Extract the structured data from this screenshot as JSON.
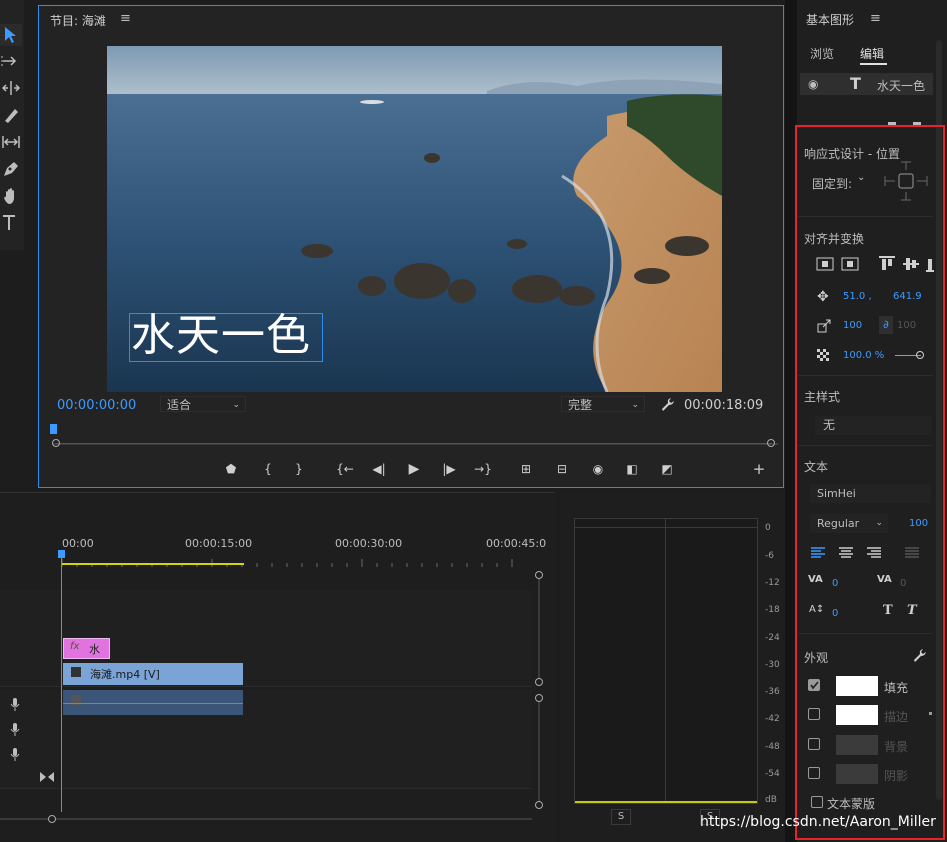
{
  "monitor": {
    "title": "节目: 海滩",
    "menu_icon": "≡",
    "current_time": "00:00:00:00",
    "fit_option": "适合",
    "quality_option": "完整",
    "duration": "00:00:18:09",
    "overlay_text": "水天一色"
  },
  "timeline": {
    "ruler": [
      "00:00",
      "00:00:15:00",
      "00:00:30:00",
      "00:00:45:0"
    ],
    "graphic_clip_label": "水",
    "video_clip_label": "海滩.mp4 [V]",
    "fx_label": "fx"
  },
  "meter": {
    "db_labels": [
      "0",
      "-6",
      "-12",
      "-18",
      "-24",
      "-30",
      "-36",
      "-42",
      "-48",
      "-54",
      "dB"
    ],
    "solo_left": "S",
    "solo_right": "S"
  },
  "panel": {
    "title": "基本图形",
    "menu_icon": "≡",
    "tab_browse": "浏览",
    "tab_edit": "编辑",
    "layer_name": "水天一色",
    "responsive_title": "响应式设计 - 位置",
    "pin_to_label": "固定到:",
    "align_title": "对齐并变换",
    "pos_x": "51.0 ,",
    "pos_y": "641.9",
    "scale_w": "100",
    "scale_h": "100",
    "opacity": "100.0 %",
    "master_style_title": "主样式",
    "master_style_value": "无",
    "text_title": "文本",
    "font_name": "SimHei",
    "font_style": "Regular",
    "font_size": "100",
    "kerning_value": "0",
    "tracking_value": "0",
    "baseline_value": "0",
    "appearance_title": "外观",
    "fill_label": "填充",
    "stroke_label": "描边",
    "background_label": "背景",
    "shadow_label": "阴影",
    "text_mask_label": "文本蒙版",
    "fill_color": "#ffffff",
    "stroke_color": "#ffffff"
  },
  "watermark": "https://blog.csdn.net/Aaron_Miller",
  "colors": {
    "accent_blue": "#2d8ceb",
    "highlight_red": "#e8242a",
    "clip_pink": "#e173e1",
    "clip_blue": "#7aa3d6"
  }
}
